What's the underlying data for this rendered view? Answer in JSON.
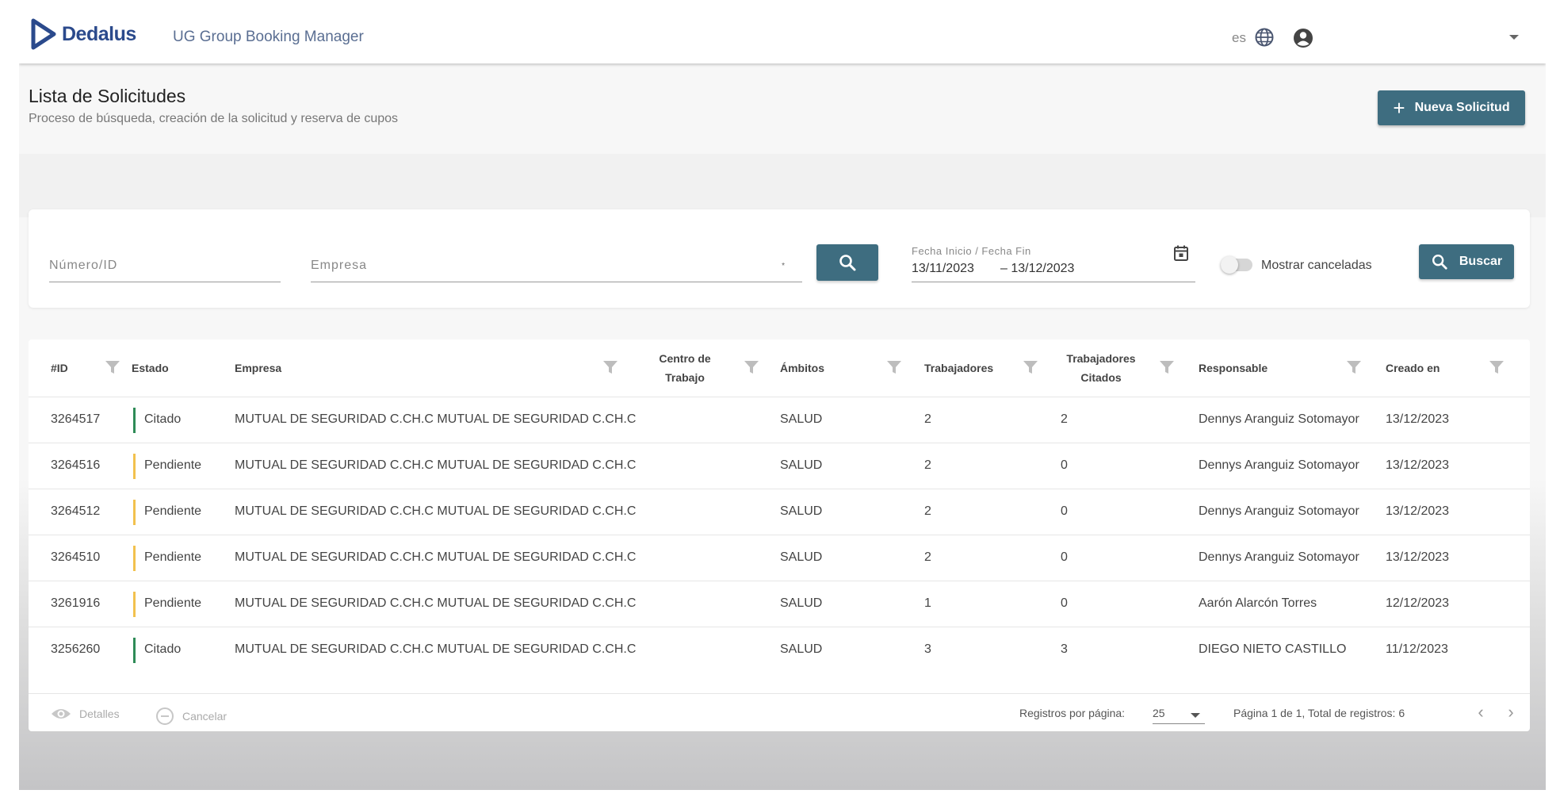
{
  "header": {
    "brand": "Dedalus",
    "app_title": "UG Group Booking Manager",
    "lang": "es"
  },
  "page": {
    "title": "Lista de Solicitudes",
    "subtitle": "Proceso de búsqueda, creación de la solicitud y reserva de cupos",
    "new_button": "Nueva Solicitud"
  },
  "filters": {
    "numero_placeholder": "Número/ID",
    "empresa_placeholder": "Empresa",
    "empresa_marker": "*",
    "date_label": "Fecha Inicio / Fecha Fin",
    "date_start": "13/11/2023",
    "date_end": "– 13/12/2023",
    "toggle_label": "Mostrar canceladas",
    "search_button": "Buscar"
  },
  "table": {
    "headers": {
      "id": "#ID",
      "estado": "Estado",
      "empresa": "Empresa",
      "centro": "Centro de Trabajo",
      "ambitos": "Ámbitos",
      "trabajadores": "Trabajadores",
      "citados": "Trabajadores Citados",
      "responsable": "Responsable",
      "creado": "Creado en"
    },
    "rows": [
      {
        "id": "3264517",
        "estado": "Citado",
        "empresa": "MUTUAL DE SEGURIDAD C.CH.C MUTUAL DE SEGURIDAD C.CH.C",
        "centro": "",
        "ambitos": "SALUD",
        "trabajadores": "2",
        "citados": "2",
        "responsable": "Dennys Aranguiz Sotomayor",
        "creado": "13/12/2023"
      },
      {
        "id": "3264516",
        "estado": "Pendiente",
        "empresa": "MUTUAL DE SEGURIDAD C.CH.C MUTUAL DE SEGURIDAD C.CH.C",
        "centro": "",
        "ambitos": "SALUD",
        "trabajadores": "2",
        "citados": "0",
        "responsable": "Dennys Aranguiz Sotomayor",
        "creado": "13/12/2023"
      },
      {
        "id": "3264512",
        "estado": "Pendiente",
        "empresa": "MUTUAL DE SEGURIDAD C.CH.C MUTUAL DE SEGURIDAD C.CH.C",
        "centro": "",
        "ambitos": "SALUD",
        "trabajadores": "2",
        "citados": "0",
        "responsable": "Dennys Aranguiz Sotomayor",
        "creado": "13/12/2023"
      },
      {
        "id": "3264510",
        "estado": "Pendiente",
        "empresa": "MUTUAL DE SEGURIDAD C.CH.C MUTUAL DE SEGURIDAD C.CH.C",
        "centro": "",
        "ambitos": "SALUD",
        "trabajadores": "2",
        "citados": "0",
        "responsable": "Dennys Aranguiz Sotomayor",
        "creado": "13/12/2023"
      },
      {
        "id": "3261916",
        "estado": "Pendiente",
        "empresa": "MUTUAL DE SEGURIDAD C.CH.C MUTUAL DE SEGURIDAD C.CH.C",
        "centro": "",
        "ambitos": "SALUD",
        "trabajadores": "1",
        "citados": "0",
        "responsable": "Aarón Alarcón Torres",
        "creado": "12/12/2023"
      },
      {
        "id": "3256260",
        "estado": "Citado",
        "empresa": "MUTUAL DE SEGURIDAD C.CH.C MUTUAL DE SEGURIDAD C.CH.C",
        "centro": "",
        "ambitos": "SALUD",
        "trabajadores": "3",
        "citados": "3",
        "responsable": "DIEGO NIETO CASTILLO",
        "creado": "11/12/2023"
      }
    ],
    "status_colors": {
      "Citado": "#2e8b57",
      "Pendiente": "#f2c14e"
    }
  },
  "footer": {
    "details": "Detalles",
    "cancel": "Cancelar",
    "per_page_label": "Registros por página:",
    "per_page_value": "25",
    "page_info": "Página 1 de 1, Total de registros: 6",
    "prev": "‹",
    "next": "›"
  },
  "colors": {
    "primary": "#3e6d80",
    "brand": "#2b4a8c"
  }
}
